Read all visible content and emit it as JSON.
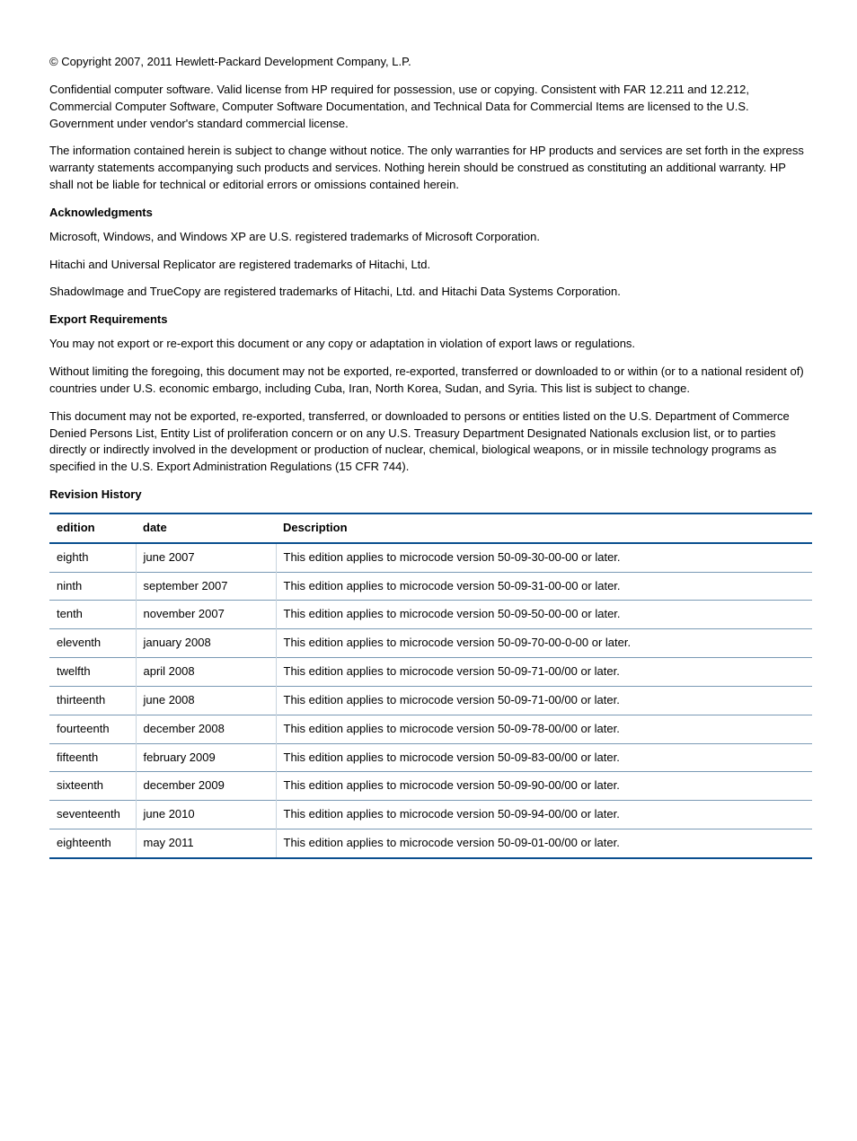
{
  "copyright": "© Copyright 2007, 2011 Hewlett-Packard Development Company, L.P.",
  "para_confidential": "Confidential computer software. Valid license from HP required for possession, use or copying. Consistent with FAR 12.211 and 12.212, Commercial Computer Software, Computer Software Documentation, and Technical Data for Commercial Items are licensed to the U.S. Government under vendor's standard commercial license.",
  "para_info": "The information contained herein is subject to change without notice. The only warranties for HP products and services are set forth in the express warranty statements accompanying such products and services. Nothing herein should be construed as constituting an additional warranty. HP shall not be liable for technical or editorial errors or omissions contained herein.",
  "ack_heading": "Acknowledgments",
  "ack_p1": "Microsoft, Windows, and Windows XP are U.S. registered trademarks of Microsoft Corporation.",
  "ack_p2": "Hitachi and Universal Replicator are registered trademarks of Hitachi, Ltd.",
  "ack_p3": "ShadowImage and TrueCopy are registered trademarks of Hitachi, Ltd. and Hitachi Data Systems Corporation.",
  "export_heading": "Export Requirements",
  "export_p1": "You may not export or re-export this document or any copy or adaptation in violation of export laws or regulations.",
  "export_p2": "Without limiting the foregoing, this document may not be exported, re-exported, transferred or downloaded to or within (or to a national resident of) countries under U.S. economic embargo, including Cuba, Iran, North Korea, Sudan, and Syria. This list is subject to change.",
  "export_p3": "This document may not be exported, re-exported, transferred, or downloaded to persons or entities listed on the U.S. Department of Commerce Denied Persons List, Entity List of proliferation concern or on any U.S. Treasury Department Designated Nationals exclusion list, or to parties directly or indirectly involved in the development or production of nuclear, chemical, biological weapons, or in missile technology programs as specified in the U.S. Export Administration Regulations (15 CFR 744).",
  "rev_heading": "Revision History",
  "table": {
    "headers": {
      "edition": "edition",
      "date": "date",
      "description": "Description"
    },
    "rows": [
      {
        "edition": "eighth",
        "date": "june 2007",
        "description": "This edition applies to microcode version 50-09-30-00-00 or later."
      },
      {
        "edition": "ninth",
        "date": "september 2007",
        "description": "This edition applies to microcode version 50-09-31-00-00 or later."
      },
      {
        "edition": "tenth",
        "date": "november 2007",
        "description": "This edition applies to microcode version 50-09-50-00-00 or later."
      },
      {
        "edition": "eleventh",
        "date": "january 2008",
        "description": "This edition applies to microcode version 50-09-70-00-0-00 or later."
      },
      {
        "edition": "twelfth",
        "date": "april 2008",
        "description": "This edition applies to microcode version 50-09-71-00/00 or later."
      },
      {
        "edition": "thirteenth",
        "date": "june 2008",
        "description": "This edition applies to microcode version 50-09-71-00/00 or later."
      },
      {
        "edition": "fourteenth",
        "date": "december 2008",
        "description": "This edition applies to microcode version 50-09-78-00/00 or later."
      },
      {
        "edition": "fifteenth",
        "date": "february 2009",
        "description": "This edition applies to microcode version 50-09-83-00/00 or later."
      },
      {
        "edition": "sixteenth",
        "date": "december 2009",
        "description": "This edition applies to microcode version 50-09-90-00/00 or later."
      },
      {
        "edition": "seventeenth",
        "date": "june 2010",
        "description": "This edition applies to microcode version 50-09-94-00/00 or later."
      },
      {
        "edition": "eighteenth",
        "date": "may 2011",
        "description": "This edition applies to microcode version 50-09-01-00/00 or later."
      }
    ]
  }
}
